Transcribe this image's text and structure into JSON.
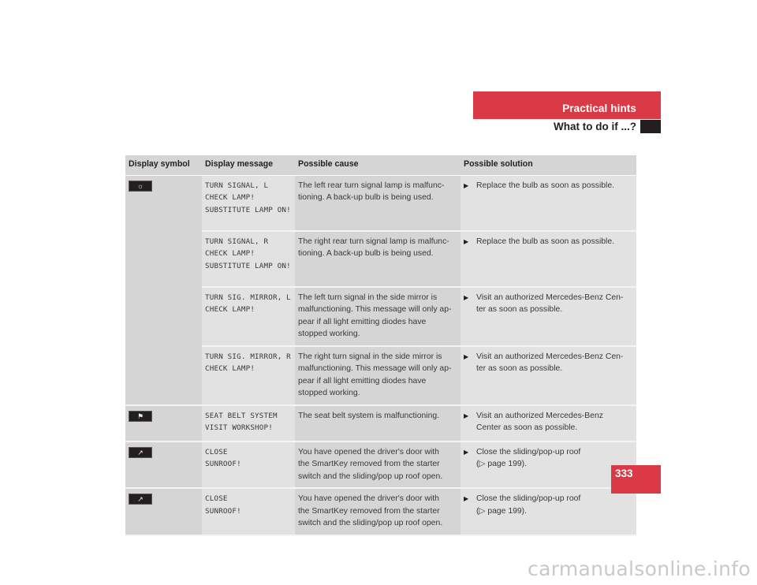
{
  "header": {
    "section_title": "Practical hints",
    "subtitle": "What to do if ...?"
  },
  "table": {
    "columns": [
      "Display symbol",
      "Display message",
      "Possible cause",
      "Possible solution"
    ],
    "rows": [
      {
        "symbol": "turn-signal-lamp-icon",
        "symbol_glyph": "☼",
        "message": [
          "TURN SIGNAL, L",
          "CHECK LAMP!",
          "SUBSTITUTE LAMP ON!"
        ],
        "cause": "The left rear turn signal lamp is malfunc-tioning. A back-up bulb is being used.",
        "cause_lines": [
          "The left rear turn signal lamp is malfunc-",
          "tioning. A back-up bulb is being used."
        ],
        "solution_lines": [
          "Replace the bulb as soon as possible."
        ]
      },
      {
        "symbol": "",
        "message": [
          "TURN SIGNAL, R",
          "CHECK LAMP!",
          "SUBSTITUTE LAMP ON!"
        ],
        "cause_lines": [
          "The right rear turn signal lamp is malfunc-",
          "tioning. A back-up bulb is being used."
        ],
        "solution_lines": [
          "Replace the bulb as soon as possible."
        ]
      },
      {
        "symbol": "",
        "message": [
          "TURN SIG. MIRROR, L",
          "CHECK LAMP!"
        ],
        "cause_lines": [
          "The left turn signal in the side mirror is",
          "malfunctioning. This message will only ap-",
          "pear if all light emitting diodes have",
          "stopped working."
        ],
        "solution_lines": [
          "Visit an authorized Mercedes-Benz Cen-",
          "ter as soon as possible."
        ]
      },
      {
        "symbol": "",
        "message": [
          "TURN SIG. MIRROR, R",
          "CHECK LAMP!"
        ],
        "cause_lines": [
          "The right turn signal in the side mirror is",
          "malfunctioning. This message will only ap-",
          "pear if all light emitting diodes have",
          "stopped working."
        ],
        "solution_lines": [
          "Visit an authorized Mercedes-Benz Cen-",
          "ter as soon as possible."
        ]
      },
      {
        "symbol": "seat-belt-icon",
        "symbol_glyph": "⚑",
        "message": [
          "SEAT BELT SYSTEM",
          "VISIT WORKSHOP!"
        ],
        "cause_lines": [
          "The seat belt system is malfunctioning."
        ],
        "solution_lines": [
          "Visit an authorized Mercedes-Benz",
          "Center as soon as possible."
        ]
      },
      {
        "symbol": "sunroof-open-icon",
        "symbol_glyph": "↗",
        "message": [
          "CLOSE",
          "SUNROOF!"
        ],
        "cause_lines": [
          "You have opened the driver's door with",
          "the SmartKey removed from the starter",
          "switch and the sliding/pop up roof open."
        ],
        "solution_lines": [
          "Close the sliding/pop-up roof",
          "(▷ page 199)."
        ]
      },
      {
        "symbol": "popup-roof-open-icon",
        "symbol_glyph": "↗",
        "message": [
          "CLOSE",
          "SUNROOF!"
        ],
        "cause_lines": [
          "You have opened the driver's door with",
          "the SmartKey removed from the starter",
          "switch and the sliding/pop up roof open."
        ],
        "solution_lines": [
          "Close the sliding/pop-up roof",
          "(▷ page 199)."
        ]
      }
    ],
    "bullet_glyph": "▶"
  },
  "page_number": "333",
  "watermark": "carmanualsonline.info",
  "colors": {
    "accent_red": "#d93a45",
    "text_dark": "#231f20",
    "cell_dark": "#d5d5d6",
    "cell_light": "#e2e2e3"
  }
}
